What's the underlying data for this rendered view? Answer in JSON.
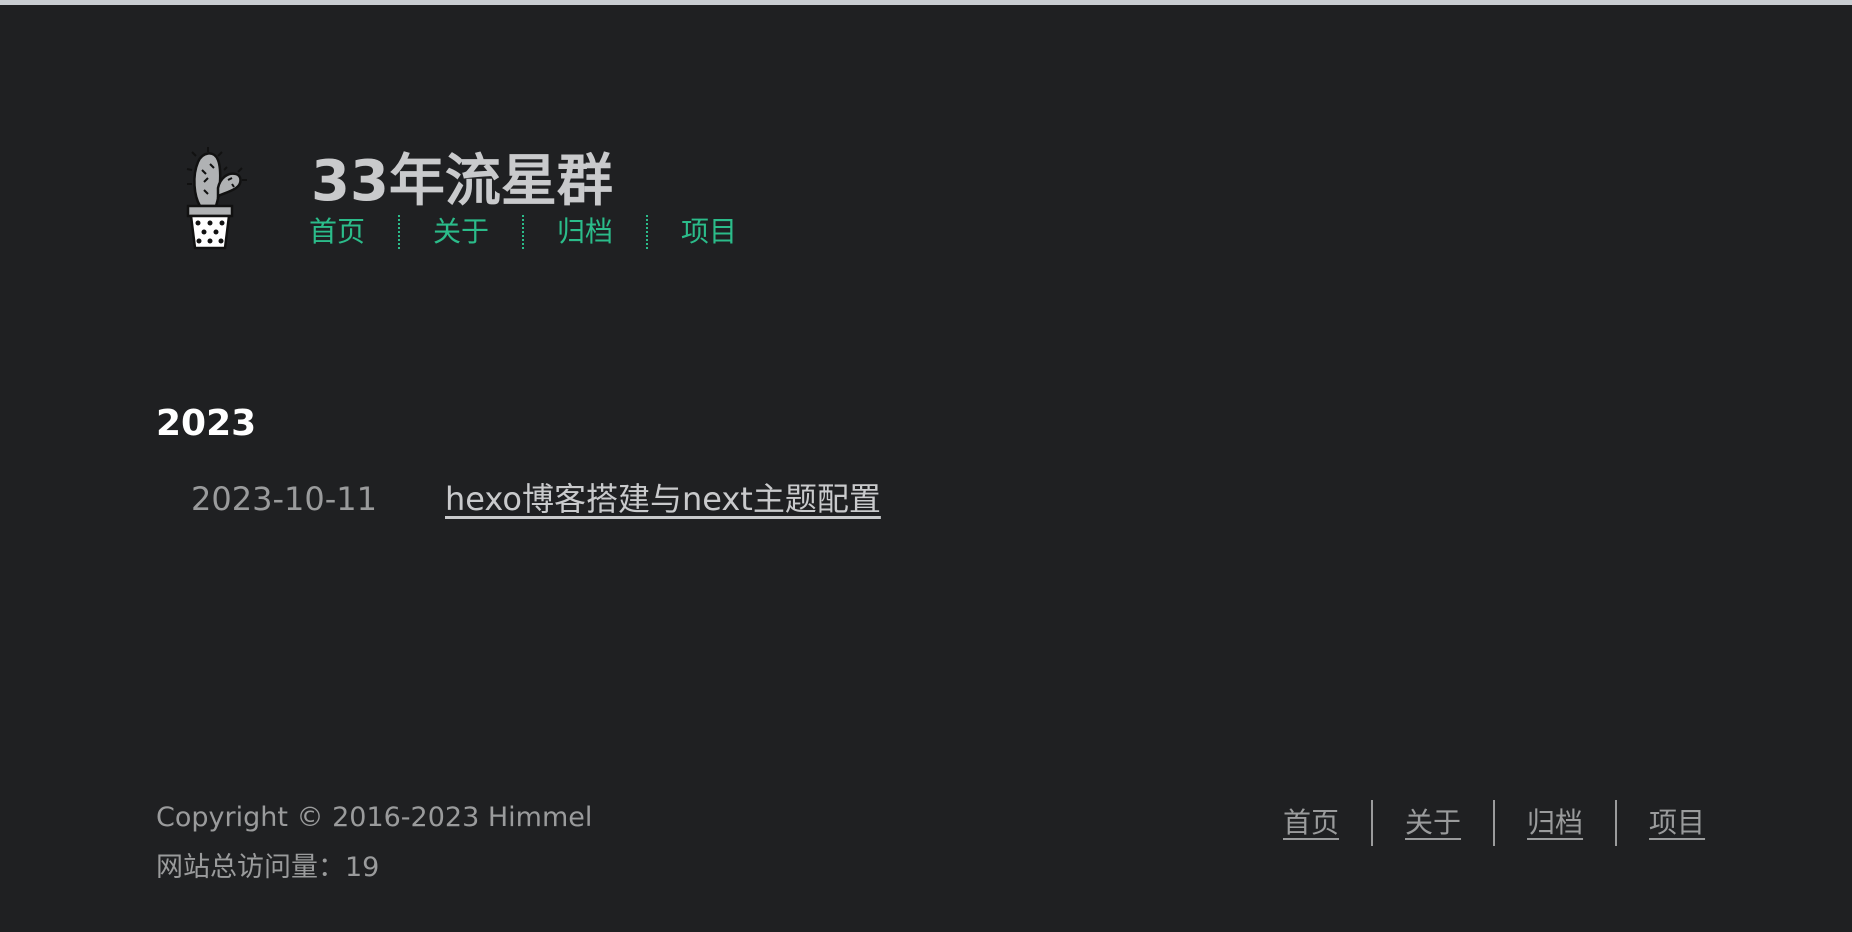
{
  "header": {
    "title": "33年流星群",
    "logo_icon": "cactus-logo-icon",
    "nav": [
      {
        "label": "首页"
      },
      {
        "label": "关于"
      },
      {
        "label": "归档"
      },
      {
        "label": "项目"
      }
    ]
  },
  "archive": {
    "year": "2023",
    "posts": [
      {
        "date": "2023-10-11",
        "title": "hexo博客搭建与next主题配置"
      }
    ]
  },
  "footer": {
    "copyright": "Copyright © 2016-2023 Himmel",
    "visits_label": "网站总访问量：",
    "visits_count": "19",
    "nav": [
      {
        "label": "首页"
      },
      {
        "label": "关于"
      },
      {
        "label": "归档"
      },
      {
        "label": "项目"
      }
    ]
  },
  "colors": {
    "background": "#1f2022",
    "accent": "#2bbc8a",
    "text": "#c9cacc",
    "muted": "#9a9b9c"
  }
}
